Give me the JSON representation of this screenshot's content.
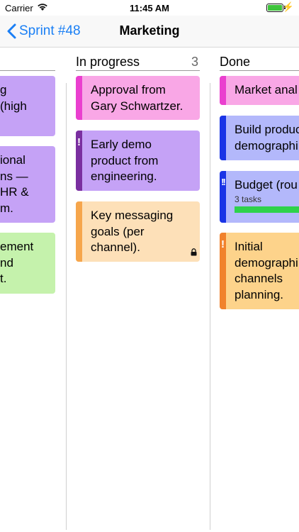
{
  "status_bar": {
    "carrier": "Carrier",
    "time": "11:45 AM"
  },
  "nav": {
    "back_label": "Sprint #48",
    "title": "Marketing"
  },
  "colors": {
    "purple_card": "#c5a2f6",
    "pink_card": "#f9a7e6",
    "peach_card": "#fde0b8",
    "green_card": "#c5f2ac",
    "blue_card": "#b3b8fb",
    "orange_card": "#fdd38b",
    "accent_blue": "#1a7ff5"
  },
  "columns": [
    {
      "title": "",
      "count": "",
      "cards": [
        {
          "text": "g\n(high",
          "color": "purple"
        },
        {
          "text": "ional\nns —\nHR &\nm.",
          "color": "purple"
        },
        {
          "text": "ement\nnd\nt.",
          "color": "green"
        }
      ]
    },
    {
      "title": "In progress",
      "count": "3",
      "cards": [
        {
          "text": "Approval from\nGary Schwartzer.",
          "color": "pink"
        },
        {
          "text": "Early demo\nproduct from\nengineering.",
          "color": "purple",
          "priority": "!"
        },
        {
          "text": "Key messaging\ngoals (per\nchannel).",
          "color": "peach",
          "locked": true
        }
      ]
    },
    {
      "title": "Done",
      "count": "",
      "cards": [
        {
          "text": "Market anal",
          "color": "pink"
        },
        {
          "text": "Build produc\ndemographi",
          "color": "blue"
        },
        {
          "text": "Budget (rou",
          "color": "blue",
          "priority": "!!",
          "subtasks_label": "3 tasks",
          "progress": 1.0
        },
        {
          "text": "Initial\ndemographi\nchannels\nplanning.",
          "color": "orange",
          "priority": "!"
        }
      ]
    }
  ]
}
